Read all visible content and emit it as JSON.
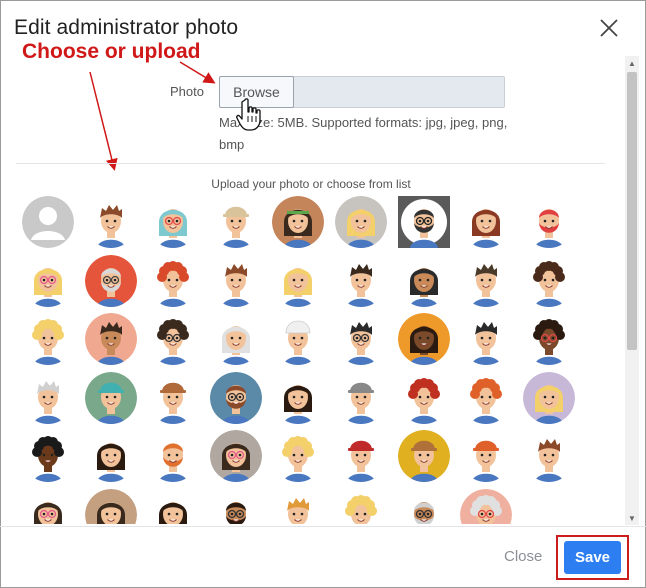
{
  "dialog": {
    "title": "Edit administrator photo",
    "close_icon": "close-icon"
  },
  "annotation": {
    "text": "Choose or upload",
    "color": "#d01818"
  },
  "photo_field": {
    "label": "Photo",
    "browse_label": "Browse",
    "hint": "Max size: 5MB. Supported formats: jpg, jpeg, png, bmp"
  },
  "upload_caption": "Upload your photo or choose from list",
  "avatars": [
    {
      "bg": "#c9c9c9",
      "skin": "#ffffff",
      "hair": "#ffffff",
      "style": "placeholder",
      "selected": false
    },
    {
      "bg": "#ffffff",
      "skin": "#f2c29a",
      "hair": "#8b4b2a",
      "style": "spiky",
      "selected": false
    },
    {
      "bg": "#ffffff",
      "skin": "#f2c29a",
      "hair": "#7ec9cf",
      "style": "long",
      "selected": false,
      "glasses": "#e14a4a"
    },
    {
      "bg": "#ffffff",
      "skin": "#f2c29a",
      "hair": "#d9c39a",
      "style": "cap",
      "selected": false
    },
    {
      "bg": "#c4855a",
      "skin": "#f2c29a",
      "hair": "#3a2a1e",
      "style": "long",
      "selected": false,
      "band": "#5aa84a"
    },
    {
      "bg": "#c7c3bf",
      "skin": "#f2c29a",
      "hair": "#f3d06a",
      "style": "long",
      "selected": false
    },
    {
      "bg": "#5a5a5a",
      "skin": "#f2c29a",
      "hair": "#333333",
      "style": "beard",
      "selected": true,
      "glasses": "#222222"
    },
    {
      "bg": "#ffffff",
      "skin": "#f2c29a",
      "hair": "#8a3a22",
      "style": "bob",
      "selected": false
    },
    {
      "bg": "#ffffff",
      "skin": "#f2c29a",
      "hair": "#e04040",
      "style": "beard",
      "selected": false
    },
    {
      "bg": "#ffffff",
      "skin": "#f2c29a",
      "hair": "#f3d06a",
      "style": "bob",
      "selected": false,
      "glasses": "#e65a8a"
    },
    {
      "bg": "#e4553b",
      "skin": "#f2c29a",
      "hair": "#d8d8d8",
      "style": "beard",
      "selected": false,
      "glasses": "#444444"
    },
    {
      "bg": "#ffffff",
      "skin": "#f2c29a",
      "hair": "#d84a2a",
      "style": "curly",
      "selected": false
    },
    {
      "bg": "#ffffff",
      "skin": "#f2c29a",
      "hair": "#8b4b2a",
      "style": "spiky",
      "selected": false
    },
    {
      "bg": "#ffffff",
      "skin": "#f2c29a",
      "hair": "#f3d06a",
      "style": "bob",
      "selected": false
    },
    {
      "bg": "#ffffff",
      "skin": "#f2c29a",
      "hair": "#3a2a1e",
      "style": "spiky",
      "selected": false
    },
    {
      "bg": "#ffffff",
      "skin": "#c98a5a",
      "hair": "#2a2a2a",
      "style": "long",
      "selected": false
    },
    {
      "bg": "#ffffff",
      "skin": "#f2c29a",
      "hair": "#4a3a2a",
      "style": "spiky",
      "selected": false
    },
    {
      "bg": "#ffffff",
      "skin": "#f2c29a",
      "hair": "#4a2a1a",
      "style": "curly",
      "selected": false
    },
    {
      "bg": "#ffffff",
      "skin": "#f2c29a",
      "hair": "#f3d06a",
      "style": "curly",
      "selected": false
    },
    {
      "bg": "#f0a890",
      "skin": "#c98a5a",
      "hair": "#3a2a1e",
      "style": "spiky",
      "selected": false
    },
    {
      "bg": "#ffffff",
      "skin": "#f2c29a",
      "hair": "#3a2a1e",
      "style": "curly",
      "selected": false,
      "glasses": "#333333"
    },
    {
      "bg": "#ffffff",
      "skin": "#f2c29a",
      "hair": "#e0e0e0",
      "style": "long",
      "selected": false
    },
    {
      "bg": "#ffffff",
      "skin": "#f2c29a",
      "hair": "#f0f0f0",
      "style": "turban",
      "selected": false
    },
    {
      "bg": "#ffffff",
      "skin": "#f2c29a",
      "hair": "#2a2a2a",
      "style": "spiky",
      "selected": false,
      "glasses": "#333333"
    },
    {
      "bg": "#ee9a2a",
      "skin": "#7a4a2a",
      "hair": "#2a1a10",
      "style": "long",
      "selected": false
    },
    {
      "bg": "#ffffff",
      "skin": "#f2c29a",
      "hair": "#2a2a2a",
      "style": "spiky",
      "selected": false
    },
    {
      "bg": "#ffffff",
      "skin": "#7a4a2a",
      "hair": "#2a1a10",
      "style": "curly",
      "selected": false,
      "glasses": "#e14a4a"
    },
    {
      "bg": "#ffffff",
      "skin": "#f2c29a",
      "hair": "#d0d0d0",
      "style": "spiky",
      "selected": false
    },
    {
      "bg": "#7aa88a",
      "skin": "#f2c29a",
      "hair": "#40b0b0",
      "style": "cap",
      "selected": false
    },
    {
      "bg": "#ffffff",
      "skin": "#f2c29a",
      "hair": "#b06a3a",
      "style": "cap",
      "selected": false
    },
    {
      "bg": "#5a8aa8",
      "skin": "#f2c29a",
      "hair": "#8b4b2a",
      "style": "beard",
      "selected": false,
      "glasses": "#333333"
    },
    {
      "bg": "#ffffff",
      "skin": "#f2c29a",
      "hair": "#2a1a10",
      "style": "bob",
      "selected": false
    },
    {
      "bg": "#ffffff",
      "skin": "#f2c29a",
      "hair": "#888888",
      "style": "cap",
      "selected": false
    },
    {
      "bg": "#ffffff",
      "skin": "#f2c29a",
      "hair": "#c03020",
      "style": "curly",
      "selected": false
    },
    {
      "bg": "#ffffff",
      "skin": "#f2c29a",
      "hair": "#e0602a",
      "style": "curly",
      "selected": false
    },
    {
      "bg": "#c8b8d8",
      "skin": "#f2c29a",
      "hair": "#f3d06a",
      "style": "bob",
      "selected": false
    },
    {
      "bg": "#ffffff",
      "skin": "#6a3a1a",
      "hair": "#1a1a1a",
      "style": "curly",
      "selected": false
    },
    {
      "bg": "#ffffff",
      "skin": "#f2c29a",
      "hair": "#2a1a10",
      "style": "bob",
      "selected": false
    },
    {
      "bg": "#ffffff",
      "skin": "#f2c29a",
      "hair": "#e07030",
      "style": "beard",
      "selected": false
    },
    {
      "bg": "#b0a8a0",
      "skin": "#f2c29a",
      "hair": "#3a2a1e",
      "style": "long",
      "selected": false,
      "glasses": "#e65a8a"
    },
    {
      "bg": "#ffffff",
      "skin": "#f2c29a",
      "hair": "#f3d06a",
      "style": "curly",
      "selected": false
    },
    {
      "bg": "#ffffff",
      "skin": "#f2c29a",
      "hair": "#c02a2a",
      "style": "cap",
      "selected": false
    },
    {
      "bg": "#e0b020",
      "skin": "#f2c29a",
      "hair": "#b0703a",
      "style": "cap",
      "selected": false
    },
    {
      "bg": "#ffffff",
      "skin": "#f2c29a",
      "hair": "#e0602a",
      "style": "cap",
      "selected": false
    },
    {
      "bg": "#ffffff",
      "skin": "#f2c29a",
      "hair": "#8b4b2a",
      "style": "spiky",
      "selected": false
    },
    {
      "bg": "#ffffff",
      "skin": "#f2c29a",
      "hair": "#3a2a1e",
      "style": "long",
      "selected": false,
      "glasses": "#e65a8a"
    },
    {
      "bg": "#c4a080",
      "skin": "#f2c29a",
      "hair": "#3a2a1e",
      "style": "long",
      "selected": false
    },
    {
      "bg": "#ffffff",
      "skin": "#f2c29a",
      "hair": "#2a1a10",
      "style": "bob",
      "selected": false
    },
    {
      "bg": "#ffffff",
      "skin": "#c98a5a",
      "hair": "#2a1a10",
      "style": "beard",
      "selected": false,
      "glasses": "#333333"
    },
    {
      "bg": "#ffffff",
      "skin": "#f2c29a",
      "hair": "#e09a3a",
      "style": "spiky",
      "selected": false
    },
    {
      "bg": "#ffffff",
      "skin": "#f2c29a",
      "hair": "#f3d06a",
      "style": "curly",
      "selected": false
    },
    {
      "bg": "#ffffff",
      "skin": "#c98a5a",
      "hair": "#d0d0d0",
      "style": "beard",
      "selected": false,
      "glasses": "#333333"
    },
    {
      "bg": "#f0b0a0",
      "skin": "#f2c29a",
      "hair": "#e0e0e0",
      "style": "curly",
      "selected": false,
      "glasses": "#e14a4a"
    }
  ],
  "footer": {
    "close_label": "Close",
    "save_label": "Save",
    "save_color": "#2d7ff1",
    "highlight_color": "#cc1d1d"
  }
}
